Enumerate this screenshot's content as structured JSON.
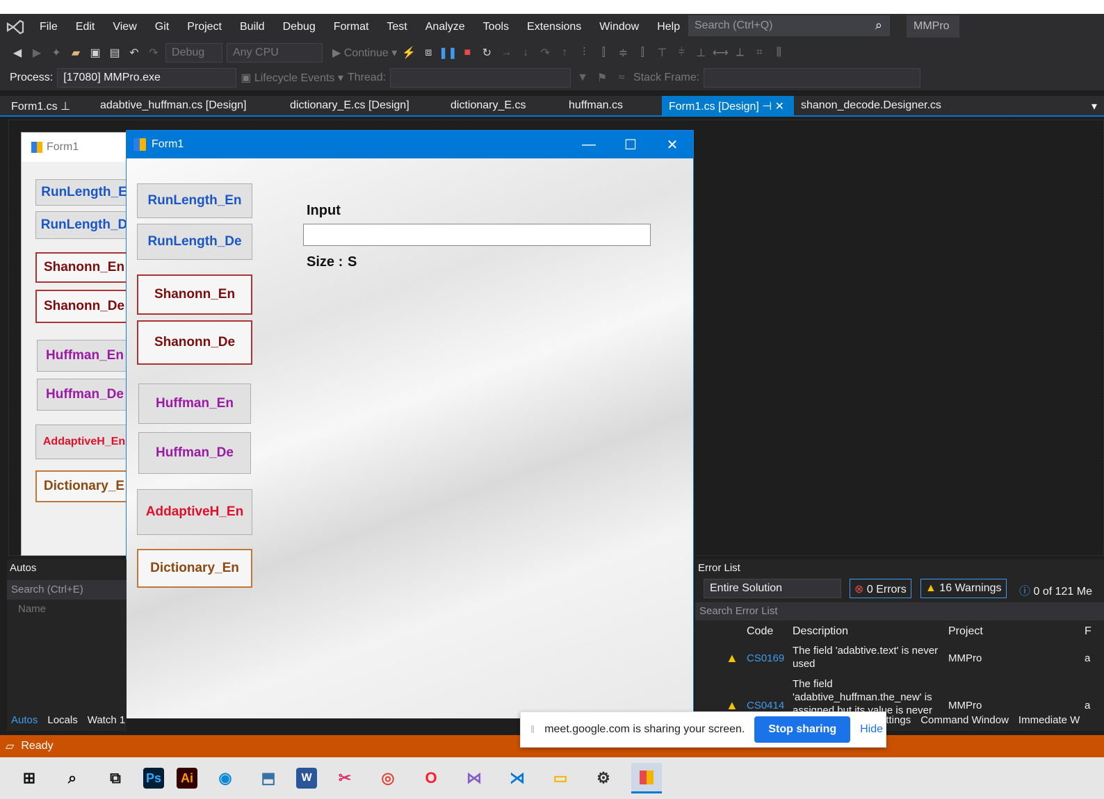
{
  "menu": {
    "items": [
      "File",
      "Edit",
      "View",
      "Git",
      "Project",
      "Build",
      "Debug",
      "Format",
      "Test",
      "Analyze",
      "Tools",
      "Extensions",
      "Window",
      "Help"
    ],
    "search_placeholder": "Search (Ctrl+Q)",
    "project_name": "MMPro"
  },
  "toolbar": {
    "config": "Debug",
    "platform": "Any CPU",
    "continue_label": "Continue"
  },
  "toolbar2": {
    "process_label": "Process:",
    "process_value": "[17080] MMPro.exe",
    "lifecycle_label": "Lifecycle Events",
    "thread_label": "Thread:",
    "stack_frame_label": "Stack Frame:"
  },
  "tabs": [
    {
      "label": "Form1.cs"
    },
    {
      "label": "adabtive_huffman.cs [Design]"
    },
    {
      "label": "dictionary_E.cs [Design]"
    },
    {
      "label": "dictionary_E.cs"
    },
    {
      "label": "huffman.cs"
    },
    {
      "label": "Form1.cs [Design]"
    },
    {
      "label": "shanon_decode.Designer.cs"
    }
  ],
  "designer_form": {
    "title": "Form1",
    "buttons": [
      "RunLength_E",
      "RunLength_D",
      "Shanonn_En",
      "Shanonn_De",
      "Huffman_En",
      "Huffman_De",
      "AddaptiveH_En",
      "Dictionary_E"
    ]
  },
  "running_form": {
    "title": "Form1",
    "buttons": [
      "RunLength_En",
      "RunLength_De",
      "Shanonn_En",
      "Shanonn_De",
      "Huffman_En",
      "Huffman_De",
      "AddaptiveH_En",
      "Dictionary_En"
    ],
    "input_label": "Input",
    "input_value": "",
    "size_label": "Size :",
    "size_value": "S"
  },
  "autos": {
    "title": "Autos",
    "search_placeholder": "Search (Ctrl+E)",
    "col_name": "Name",
    "tabs": [
      "Autos",
      "Locals",
      "Watch 1"
    ]
  },
  "error_list": {
    "title": "Error List",
    "scope": "Entire Solution",
    "errors": "0 Errors",
    "warnings": "16 Warnings",
    "messages": "0 of 121 Me",
    "search_placeholder": "Search Error List",
    "columns": {
      "code": "Code",
      "description": "Description",
      "project": "Project",
      "file": "F"
    },
    "rows": [
      {
        "code": "CS0169",
        "description": "The field 'adabtive.text' is never used",
        "project": "MMPro",
        "file": "a"
      },
      {
        "code": "CS0414",
        "description": "The field 'adabtive_huffman.the_new' is assigned but its value is never",
        "project": "MMPro",
        "file": "a"
      }
    ],
    "bottom_tabs": [
      "Settings",
      "Command Window",
      "Immediate W"
    ]
  },
  "status": {
    "text": "Ready"
  },
  "share_bar": {
    "message": "meet.google.com is sharing your screen.",
    "stop_label": "Stop sharing",
    "hide_label": "Hide"
  },
  "taskbar": {
    "ps_label": "Ps",
    "ai_label": "Ai",
    "word_label": "W"
  },
  "colors": {
    "accent": "#007acc",
    "status_bar": "#ca5100",
    "form_titlebar": "#0078d7"
  }
}
